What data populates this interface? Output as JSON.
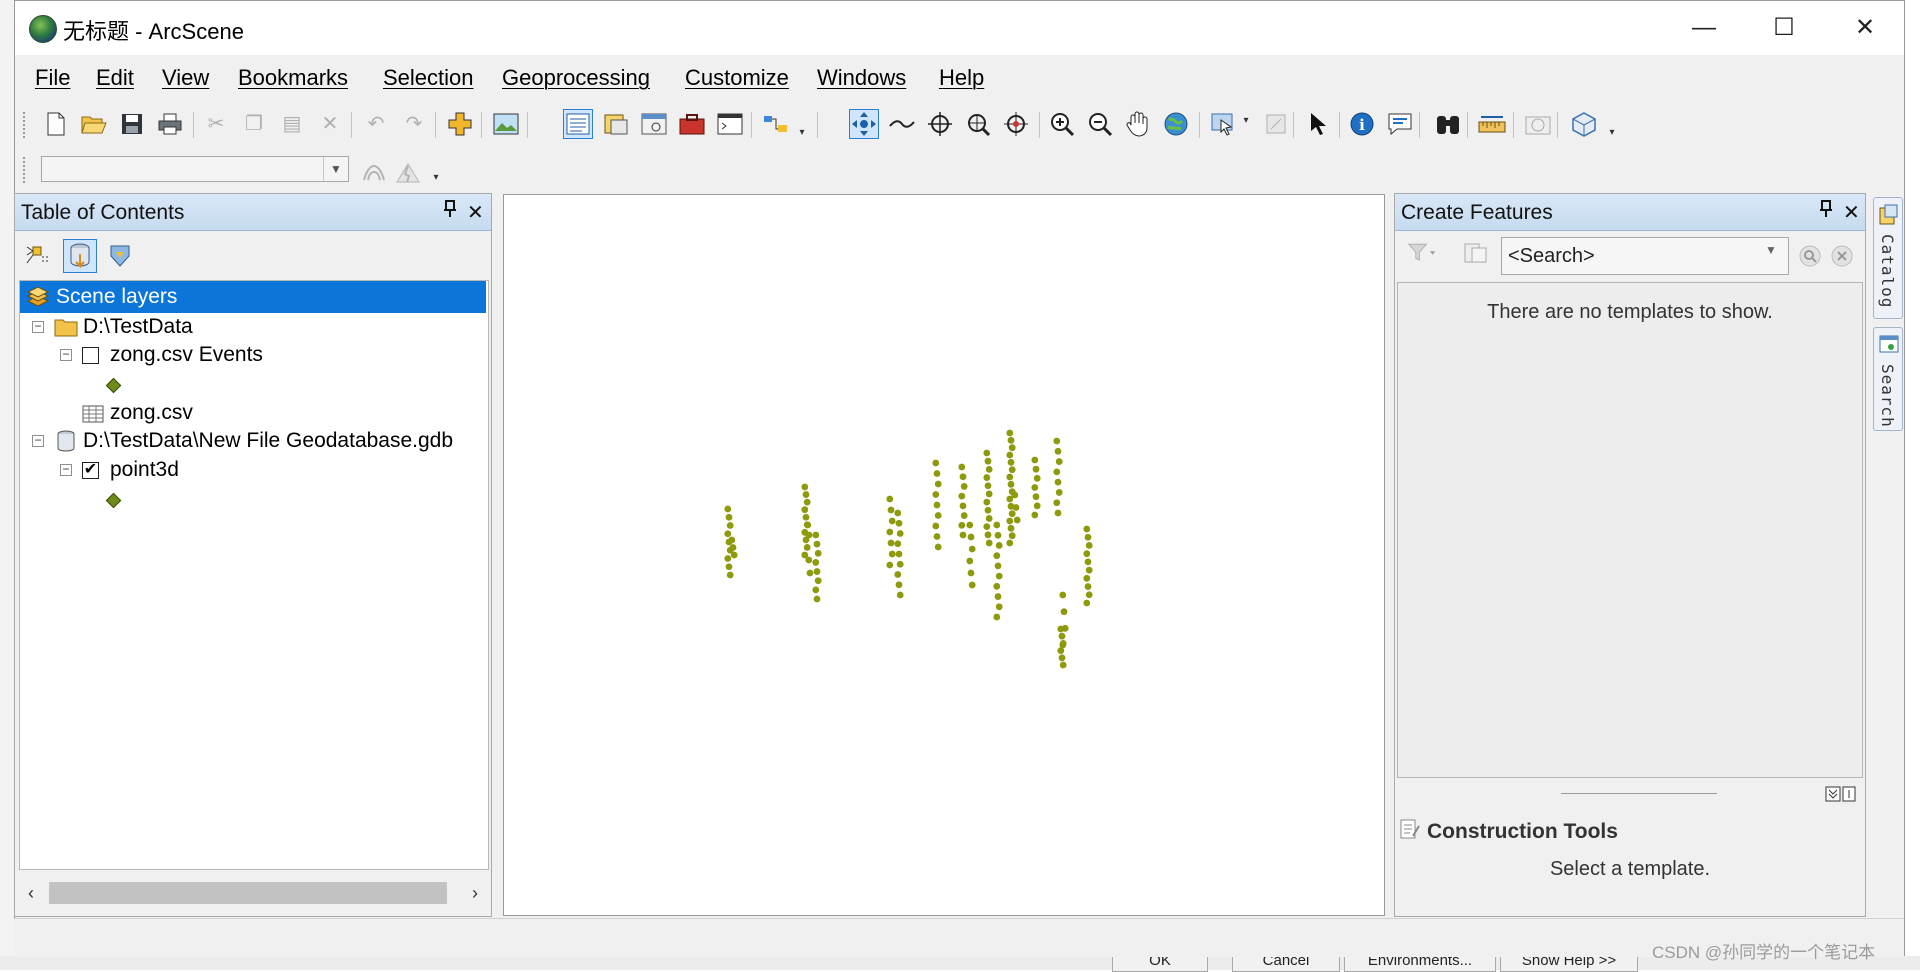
{
  "window": {
    "title": "无标题 - ArcScene"
  },
  "window_controls": {
    "minimize": "—",
    "maximize": "☐",
    "close": "✕"
  },
  "menu": [
    {
      "label": "File"
    },
    {
      "label": "Edit"
    },
    {
      "label": "View"
    },
    {
      "label": "Bookmarks"
    },
    {
      "label": "Selection"
    },
    {
      "label": "Geoprocessing"
    },
    {
      "label": "Customize"
    },
    {
      "label": "Windows"
    },
    {
      "label": "Help"
    }
  ],
  "toolbar_icons": [
    "new-document-icon",
    "open-folder-icon",
    "save-icon",
    "print-icon",
    "cut-icon",
    "copy-icon",
    "paste-icon",
    "delete-icon",
    "undo-icon",
    "redo-icon",
    "add-data-icon",
    "scene-properties-icon",
    "table-of-contents-icon",
    "arccatalog-icon",
    "search-window-icon",
    "arctoolbox-icon",
    "python-window-icon",
    "model-builder-icon",
    "navigate-icon",
    "fly-icon",
    "target-center-icon",
    "zoom-to-target-icon",
    "set-observer-icon",
    "zoom-in-icon",
    "zoom-out-icon",
    "pan-icon",
    "full-extent-icon",
    "select-features-icon",
    "clear-selection-icon",
    "select-elements-icon",
    "identify-icon",
    "html-popup-icon",
    "find-icon",
    "measure-icon",
    "animation-icon",
    "3d-effects-icon"
  ],
  "toc": {
    "title": "Table of Contents",
    "tree": [
      {
        "label": "Scene layers",
        "selected": true
      },
      {
        "label": "D:\\TestData"
      },
      {
        "label": "zong.csv Events",
        "checked": false
      },
      {
        "label": "zong.csv"
      },
      {
        "label": "D:\\TestData\\New File Geodatabase.gdb"
      },
      {
        "label": "point3d",
        "checked": true
      }
    ]
  },
  "scene": {
    "point_color": "#8c9a0c"
  },
  "create_features": {
    "title": "Create Features",
    "search_placeholder": "<Search>",
    "empty_message": "There are no templates to show.",
    "construction_tools_title": "Construction Tools",
    "construction_tools_message": "Select a template."
  },
  "dock_tabs": {
    "catalog": "Catalog",
    "search": "Search"
  },
  "background": {
    "ok": "OK",
    "cancel": "Cancel",
    "environments": "Environments...",
    "show_help": "Show Help >>"
  },
  "watermark": "CSDN @孙同学的一个笔记本"
}
